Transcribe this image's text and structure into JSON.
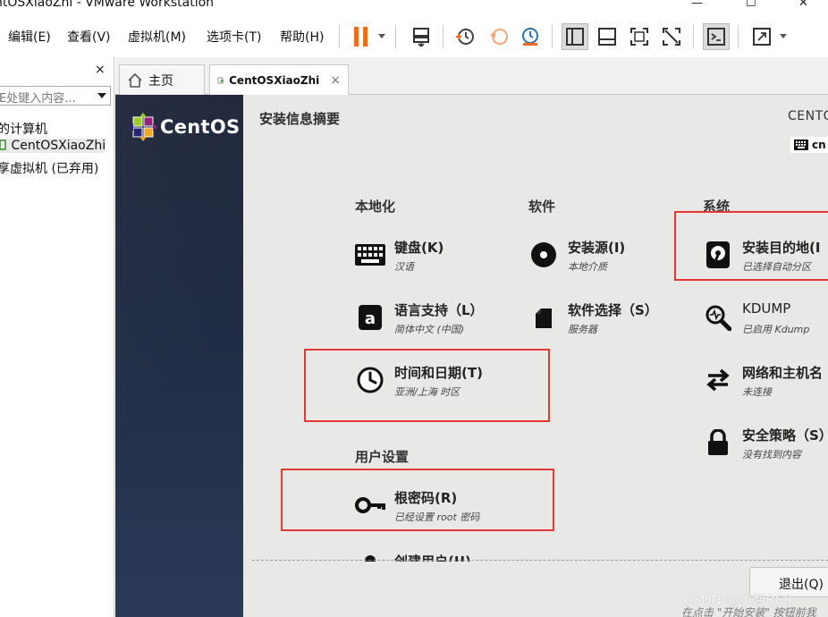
{
  "window": {
    "title": "ntOSXiaoZhi - VMware Workstation",
    "close_glyph": "✕"
  },
  "menu": {
    "items": [
      "编辑(E)",
      "查看(V)",
      "虚拟机(M)",
      "选项卡(T)",
      "帮助(H)"
    ]
  },
  "toolbar": {
    "icons": [
      "pause-icon",
      "send-ctrl-alt-del-icon",
      "snapshot-icon",
      "revert-snapshot-icon",
      "snapshot-manager-icon",
      "library-view-icon",
      "console-view-icon",
      "fullscreen-icon",
      "unity-icon",
      "terminal-icon",
      "stretch-icon"
    ],
    "accent_color": "#f06a1f"
  },
  "sidebar": {
    "close_glyph": "×",
    "search_placeholder": "E处键入内容...",
    "items": [
      {
        "label": "的计算机"
      },
      {
        "label": "CentOSXiaoZhi"
      },
      {
        "label": "享虚拟机 (已弃用)"
      }
    ]
  },
  "tabs": {
    "home_label": "主页",
    "vm_label": "CentOSXiaoZhi",
    "close_glyph": "×"
  },
  "installer": {
    "logo_text": "CentOS",
    "title": "安装信息摘要",
    "os_name": "CENTO",
    "keyboard_layout": "cn",
    "sections": {
      "localization": "本地化",
      "software": "软件",
      "system": "系统",
      "user_settings": "用户设置"
    },
    "spokes": {
      "keyboard": {
        "label": "键盘(K)",
        "status": "汉语",
        "icon": "keyboard-icon"
      },
      "language": {
        "label": "语言支持（L）",
        "status": "简体中文 (中国)",
        "icon": "language-icon"
      },
      "datetime": {
        "label": "时间和日期(T)",
        "status": "亚洲/上海 时区",
        "icon": "clock-icon"
      },
      "source": {
        "label": "安装源(I)",
        "status": "本地介质",
        "icon": "disc-icon"
      },
      "software_selection": {
        "label": "软件选择（S）",
        "status": "服务器",
        "icon": "package-icon"
      },
      "destination": {
        "label": "安装目的地(I",
        "status": "已选择自动分区",
        "icon": "harddisk-icon"
      },
      "kdump": {
        "label": "KDUMP",
        "status": "已启用 Kdump",
        "icon": "search-icon"
      },
      "network": {
        "label": "网络和主机名",
        "status": "未连接",
        "icon": "network-arrows-icon"
      },
      "security": {
        "label": "安全策略（S）",
        "status": "没有找到内容",
        "icon": "lock-icon"
      },
      "root_password": {
        "label": "根密码(R)",
        "status": "已经设置 root 密码",
        "icon": "key-icon"
      },
      "create_user": {
        "label": "创建用户(U)",
        "icon": "user-icon"
      }
    },
    "quit_label": "退出(Q)",
    "footer_note": "在点击 \"开始安装\" 按钮前我",
    "highlight_color": "#e53935"
  },
  "watermark": "CSDN @小智RE0"
}
